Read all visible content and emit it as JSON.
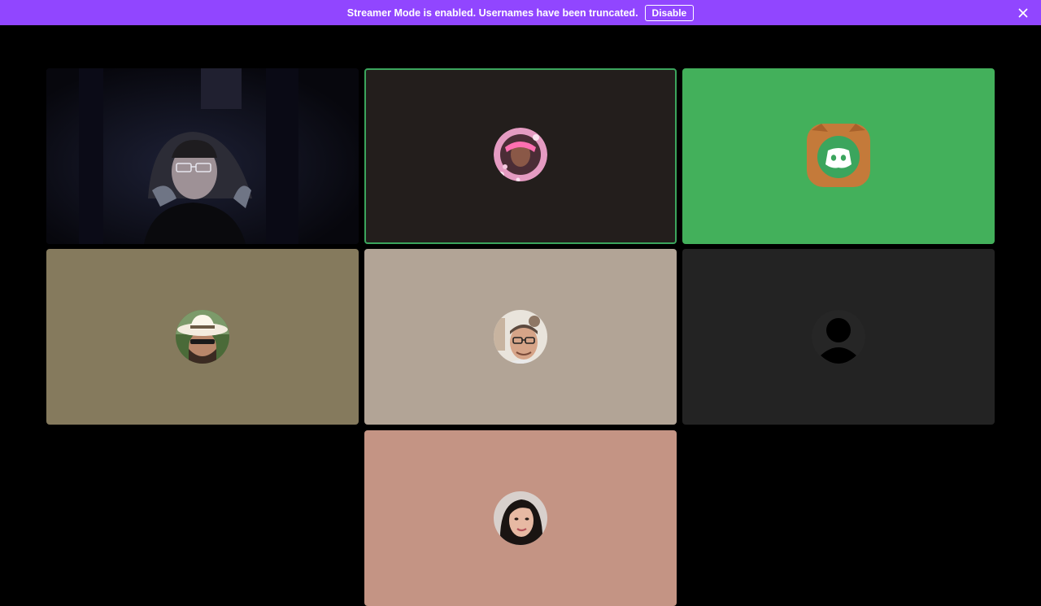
{
  "banner": {
    "message": "Streamer Mode is enabled. Usernames have been truncated.",
    "disable_label": "Disable",
    "close_icon": "close-icon",
    "background": "#9146ff"
  },
  "tiles": [
    {
      "type": "camera",
      "background": "#0e0e1c",
      "speaking": false,
      "icon": "webcam-video"
    },
    {
      "type": "avatar",
      "background": "#231e1c",
      "speaking": true,
      "icon": "pink-flower-frame-avatar"
    },
    {
      "type": "avatar",
      "background": "#43b05b",
      "speaking": false,
      "icon": "discord-cat-avatar"
    },
    {
      "type": "avatar",
      "background": "#857a5d",
      "speaking": false,
      "icon": "cowboy-hat-avatar"
    },
    {
      "type": "avatar",
      "background": "#b2a496",
      "speaking": false,
      "icon": "glasses-man-avatar"
    },
    {
      "type": "avatar",
      "background": "#232323",
      "speaking": false,
      "icon": "default-user-avatar"
    },
    {
      "type": "avatar",
      "background": "#c49484",
      "speaking": false,
      "icon": "woman-avatar"
    }
  ],
  "colors": {
    "speaking_border": "#3ba55d",
    "app_background": "#000000"
  }
}
